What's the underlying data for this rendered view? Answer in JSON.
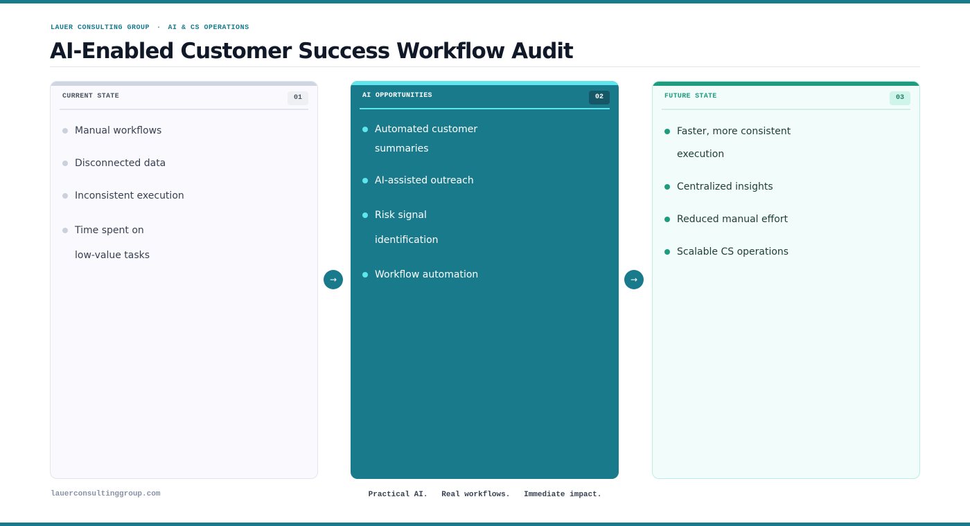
{
  "header": {
    "brand": "LAUER CONSULTING GROUP",
    "separator": "·",
    "section": "AI & CS OPERATIONS",
    "title": "AI-Enabled Customer Success Workflow Audit"
  },
  "colors": {
    "accent": "#197a8c",
    "cyan": "#5ee6ee",
    "green": "#1f9c80",
    "text_dark": "#111827"
  },
  "cards": [
    {
      "heading": "CURRENT STATE",
      "badge": "01",
      "items": [
        "Manual workflows",
        "Disconnected data",
        "Inconsistent execution",
        "Time spent on low-value tasks"
      ]
    },
    {
      "heading": "AI OPPORTUNITIES",
      "badge": "02",
      "items": [
        "Automated customer summaries",
        "AI-assisted outreach",
        "Risk signal identification",
        "Workflow automation"
      ]
    },
    {
      "heading": "FUTURE STATE",
      "badge": "03",
      "items": [
        "Faster, more consistent execution",
        "Centralized insights",
        "Reduced manual effort",
        "Scalable CS operations"
      ]
    }
  ],
  "connectors": {
    "icon": "arrow-right-icon",
    "glyph": "→"
  },
  "footer": {
    "website": "lauerconsultinggroup.com",
    "tagline": "Practical AI.   Real workflows.   Immediate impact."
  }
}
